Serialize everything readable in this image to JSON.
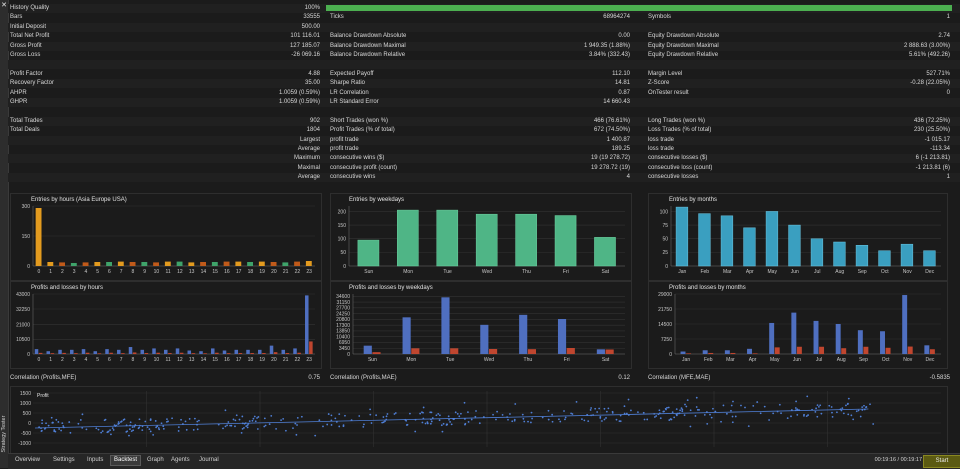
{
  "colors": {
    "background": "#1b1b1b",
    "quality_bar": "#4caf50",
    "hours_bar": "#e39b1f",
    "hours_bar2": "#c05a1a",
    "hours_green": "#3fa36a",
    "weekday_bar": "#4fb586",
    "month_bar": "#3a9fc0",
    "profit_bar": "#4f6fc0",
    "loss_bar": "#c0462f",
    "scatter": "#4f7fd6",
    "start_button": "#5b5a12"
  },
  "sidebar": {
    "close_icon": "close-icon",
    "vertical_title": "Strategy Tester"
  },
  "stats": {
    "rows": [
      {
        "c1_label": "History Quality",
        "c1_value": "100%",
        "c2_label": "",
        "c2_value": "",
        "c3_label": "",
        "c3_value": ""
      },
      {
        "c1_label": "Bars",
        "c1_value": "33555",
        "c2_label": "Ticks",
        "c2_value": "68964274",
        "c3_label": "Symbols",
        "c3_value": "1"
      },
      {
        "c1_label": "Initial Deposit",
        "c1_value": "500.00",
        "c2_label": "",
        "c2_value": "",
        "c3_label": "",
        "c3_value": ""
      },
      {
        "c1_label": "Total Net Profit",
        "c1_value": "101 116.01",
        "c2_label": "Balance Drawdown Absolute",
        "c2_value": "0.00",
        "c3_label": "Equity Drawdown Absolute",
        "c3_value": "2.74"
      },
      {
        "c1_label": "Gross Profit",
        "c1_value": "127 185.07",
        "c2_label": "Balance Drawdown Maximal",
        "c2_value": "1 949.35 (1.88%)",
        "c3_label": "Equity Drawdown Maximal",
        "c3_value": "2 888.63 (3.00%)"
      },
      {
        "c1_label": "Gross Loss",
        "c1_value": "-26 069.16",
        "c2_label": "Balance Drawdown Relative",
        "c2_value": "3.84% (332.43)",
        "c3_label": "Equity Drawdown Relative",
        "c3_value": "5.61% (492.26)"
      },
      {
        "c1_label": "",
        "c1_value": "",
        "c2_label": "",
        "c2_value": "",
        "c3_label": "",
        "c3_value": ""
      },
      {
        "c1_label": "Profit Factor",
        "c1_value": "4.88",
        "c2_label": "Expected Payoff",
        "c2_value": "112.10",
        "c3_label": "Margin Level",
        "c3_value": "527.71%"
      },
      {
        "c1_label": "Recovery Factor",
        "c1_value": "35.00",
        "c2_label": "Sharpe Ratio",
        "c2_value": "14.81",
        "c3_label": "Z-Score",
        "c3_value": "-0.28 (22.05%)"
      },
      {
        "c1_label": "AHPR",
        "c1_value": "1.0059 (0.59%)",
        "c2_label": "LR Correlation",
        "c2_value": "0.87",
        "c3_label": "OnTester result",
        "c3_value": "0"
      },
      {
        "c1_label": "GHPR",
        "c1_value": "1.0059 (0.59%)",
        "c2_label": "LR Standard Error",
        "c2_value": "14 660.43",
        "c3_label": "",
        "c3_value": ""
      },
      {
        "c1_label": "",
        "c1_value": "",
        "c2_label": "",
        "c2_value": "",
        "c3_label": "",
        "c3_value": ""
      },
      {
        "c1_label": "Total Trades",
        "c1_value": "902",
        "c2_label": "Short Trades (won %)",
        "c2_value": "466 (76.61%)",
        "c3_label": "Long Trades (won %)",
        "c3_value": "436 (72.25%)"
      },
      {
        "c1_label": "Total Deals",
        "c1_value": "1804",
        "c2_label": "Profit Trades (% of total)",
        "c2_value": "672 (74.50%)",
        "c3_label": "Loss Trades (% of total)",
        "c3_value": "230 (25.50%)"
      },
      {
        "c1_label": "",
        "c1_value": "Largest",
        "c2_label": "profit trade",
        "c2_value": "1 400.87",
        "c3_label": "loss trade",
        "c3_value": "-1 015.17"
      },
      {
        "c1_label": "",
        "c1_value": "Average",
        "c2_label": "profit trade",
        "c2_value": "189.25",
        "c3_label": "loss trade",
        "c3_value": "-113.34"
      },
      {
        "c1_label": "",
        "c1_value": "Maximum",
        "c2_label": "consecutive wins ($)",
        "c2_value": "19 (19 278.72)",
        "c3_label": "consecutive losses ($)",
        "c3_value": "6 (-1 213.81)"
      },
      {
        "c1_label": "",
        "c1_value": "Maximal",
        "c2_label": "consecutive profit (count)",
        "c2_value": "19 278.72 (19)",
        "c3_label": "consecutive loss (count)",
        "c3_value": "-1 213.81 (6)"
      },
      {
        "c1_label": "",
        "c1_value": "Average",
        "c2_label": "consecutive wins",
        "c2_value": "4",
        "c3_label": "consecutive losses",
        "c3_value": "1"
      }
    ]
  },
  "charts": {
    "hours": {
      "title": "Entries by hours (Asia Europe USA)",
      "yticks": [
        "0",
        "150",
        "300"
      ],
      "xticks": [
        "0",
        "1",
        "2",
        "3",
        "4",
        "5",
        "6",
        "7",
        "8",
        "9",
        "10",
        "11",
        "12",
        "13",
        "14",
        "15",
        "16",
        "17",
        "18",
        "19",
        "20",
        "21",
        "22",
        "23"
      ]
    },
    "weekdays": {
      "title": "Entries by weekdays",
      "yticks": [
        "0",
        "50",
        "100",
        "150",
        "200"
      ],
      "xticks": [
        "Sun",
        "Mon",
        "Tue",
        "Wed",
        "Thu",
        "Fri",
        "Sat"
      ]
    },
    "months": {
      "title": "Entries by months",
      "yticks": [
        "0",
        "25",
        "50",
        "75",
        "100"
      ],
      "xticks": [
        "Jan",
        "Feb",
        "Mar",
        "Apr",
        "May",
        "Jun",
        "Jul",
        "Aug",
        "Sep",
        "Oct",
        "Nov",
        "Dec"
      ]
    },
    "pl_hours": {
      "title": "Profits and losses by hours",
      "yticks": [
        "0",
        "10500",
        "21000",
        "32250",
        "43000"
      ],
      "xticks": [
        "0",
        "1",
        "2",
        "3",
        "4",
        "5",
        "6",
        "7",
        "8",
        "9",
        "10",
        "11",
        "12",
        "13",
        "14",
        "15",
        "16",
        "17",
        "18",
        "19",
        "20",
        "21",
        "22",
        "23"
      ]
    },
    "pl_weekdays": {
      "title": "Profits and losses by weekdays",
      "yticks": [
        "0",
        "3450",
        "6950",
        "10400",
        "13850",
        "17300",
        "20800",
        "24250",
        "27700",
        "31150",
        "34600"
      ],
      "xticks": [
        "Sun",
        "Mon",
        "Tue",
        "Wed",
        "Thu",
        "Fri",
        "Sat"
      ]
    },
    "pl_months": {
      "title": "Profits and losses by months",
      "yticks": [
        "0",
        "7250",
        "14500",
        "21750",
        "29000"
      ],
      "xticks": [
        "Jan",
        "Feb",
        "Mar",
        "Apr",
        "May",
        "Jun",
        "Jul",
        "Aug",
        "Sep",
        "Oct",
        "Nov",
        "Dec"
      ]
    },
    "correlations": [
      {
        "label": "Correlation (Profits,MFE)",
        "value": "0.75"
      },
      {
        "label": "Correlation (Profits,MAE)",
        "value": "0.12"
      },
      {
        "label": "Correlation (MFE,MAE)",
        "value": "-0.5835"
      }
    ],
    "scatter": {
      "title": "Profit",
      "yticks": [
        "1500",
        "1000",
        "500",
        "0",
        "-500",
        "-1000"
      ]
    }
  },
  "chart_data": [
    {
      "type": "bar",
      "title": "Entries by hours (Asia Europe USA)",
      "categories": [
        "0",
        "1",
        "2",
        "3",
        "4",
        "5",
        "6",
        "7",
        "8",
        "9",
        "10",
        "11",
        "12",
        "13",
        "14",
        "15",
        "16",
        "17",
        "18",
        "19",
        "20",
        "21",
        "22",
        "23"
      ],
      "values": [
        290,
        20,
        18,
        15,
        18,
        20,
        20,
        22,
        20,
        20,
        18,
        22,
        22,
        18,
        20,
        20,
        22,
        22,
        20,
        22,
        20,
        18,
        22,
        25
      ],
      "ylim": [
        0,
        300
      ]
    },
    {
      "type": "bar",
      "title": "Entries by weekdays",
      "categories": [
        "Sun",
        "Mon",
        "Tue",
        "Wed",
        "Thu",
        "Fri",
        "Sat"
      ],
      "values": [
        95,
        205,
        205,
        190,
        190,
        185,
        105
      ],
      "ylim": [
        0,
        220
      ]
    },
    {
      "type": "bar",
      "title": "Entries by months",
      "categories": [
        "Jan",
        "Feb",
        "Mar",
        "Apr",
        "May",
        "Jun",
        "Jul",
        "Aug",
        "Sep",
        "Oct",
        "Nov",
        "Dec"
      ],
      "values": [
        108,
        96,
        92,
        70,
        100,
        75,
        50,
        44,
        38,
        28,
        40,
        28
      ],
      "ylim": [
        0,
        110
      ]
    },
    {
      "type": "bar",
      "title": "Profits and losses by hours",
      "categories": [
        "0",
        "1",
        "2",
        "3",
        "4",
        "5",
        "6",
        "7",
        "8",
        "9",
        "10",
        "11",
        "12",
        "13",
        "14",
        "15",
        "16",
        "17",
        "18",
        "19",
        "20",
        "21",
        "22",
        "23"
      ],
      "series": [
        {
          "name": "Profits",
          "values": [
            3500,
            2000,
            3000,
            3000,
            3500,
            2000,
            3500,
            3000,
            5000,
            3000,
            4000,
            3000,
            4000,
            2500,
            2000,
            4000,
            2500,
            3000,
            3000,
            3000,
            6000,
            3000,
            4000,
            42000
          ]
        },
        {
          "name": "Losses",
          "values": [
            800,
            600,
            800,
            600,
            900,
            500,
            900,
            600,
            1100,
            700,
            900,
            700,
            900,
            600,
            500,
            900,
            600,
            700,
            700,
            700,
            1300,
            700,
            900,
            9000
          ]
        }
      ],
      "ylim": [
        0,
        43000
      ]
    },
    {
      "type": "bar",
      "title": "Profits and losses by weekdays",
      "categories": [
        "Sun",
        "Mon",
        "Tue",
        "Wed",
        "Thu",
        "Fri",
        "Sat"
      ],
      "series": [
        {
          "name": "Profits",
          "values": [
            5000,
            22000,
            34000,
            17500,
            23500,
            21000,
            2800
          ]
        },
        {
          "name": "Losses",
          "values": [
            1100,
            3400,
            3400,
            3000,
            2900,
            3600,
            2700
          ]
        }
      ],
      "ylim": [
        0,
        36000
      ]
    },
    {
      "type": "bar",
      "title": "Profits and losses by months",
      "categories": [
        "Jan",
        "Feb",
        "Mar",
        "Apr",
        "May",
        "Jun",
        "Jul",
        "Aug",
        "Sep",
        "Oct",
        "Nov",
        "Dec"
      ],
      "series": [
        {
          "name": "Profits",
          "values": [
            1200,
            1800,
            1800,
            2500,
            15000,
            20000,
            16000,
            14500,
            11500,
            11000,
            28500,
            4200
          ]
        },
        {
          "name": "Losses",
          "values": [
            300,
            500,
            500,
            300,
            3200,
            3500,
            3500,
            2800,
            3500,
            3000,
            3600,
            2300
          ]
        }
      ],
      "ylim": [
        0,
        29000
      ]
    },
    {
      "type": "scatter",
      "title": "Profit",
      "ylim": [
        -1200,
        1600
      ]
    }
  ],
  "tabs": [
    {
      "label": "Overview",
      "active": false
    },
    {
      "label": "Settings",
      "active": false
    },
    {
      "label": "Inputs",
      "active": false
    },
    {
      "label": "Backtest",
      "active": true
    },
    {
      "label": "Graph",
      "active": false
    },
    {
      "label": "Agents",
      "active": false
    },
    {
      "label": "Journal",
      "active": false
    }
  ],
  "timer": "00:19:16 / 00:19:17",
  "start_label": "Start"
}
